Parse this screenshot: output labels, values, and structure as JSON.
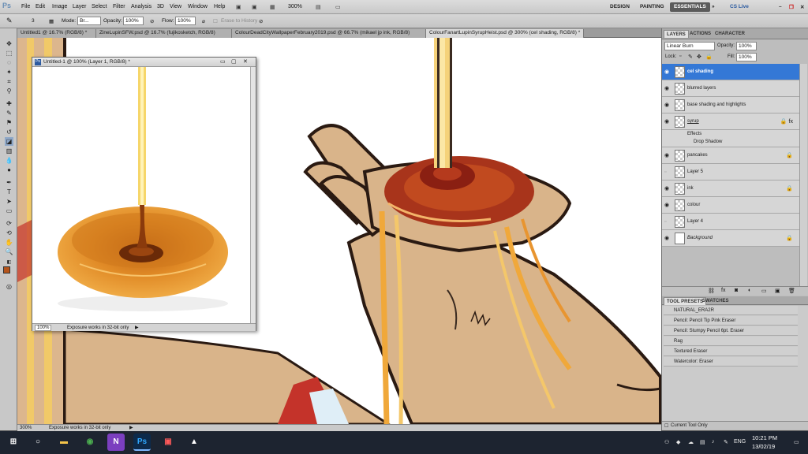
{
  "app": {
    "logo": "Ps"
  },
  "menubar": {
    "items": [
      "File",
      "Edit",
      "Image",
      "Layer",
      "Select",
      "Filter",
      "Analysis",
      "3D",
      "View",
      "Window",
      "Help"
    ],
    "zoom": "300%",
    "workspaces": [
      "DESIGN",
      "PAINTING",
      "ESSENTIALS"
    ],
    "cslive": "CS Live"
  },
  "options": {
    "brush_size": "3",
    "mode_label": "Mode:",
    "mode_value": "Br...",
    "opacity_label": "Opacity:",
    "opacity_value": "100%",
    "flow_label": "Flow:",
    "flow_value": "100%",
    "erase_history": "Erase to History"
  },
  "tabs": [
    "Untitled1 @ 16.7% (RGB/8) *",
    "ZineLupinSFW.psd @ 16.7% (fujikosketch, RGB/8)",
    "ColourDeadCityWallpaperFebruary2019.psd @ 66.7% (mikael jp ink, RGB/8)",
    "ColourFanartLupinSyrupHeist.psd @ 300% (cel shading, RGB/8) *"
  ],
  "float_window": {
    "title": "Untitled-1 @ 100% (Layer 1, RGB/8) *",
    "zoom": "100%",
    "status": "Exposure works in 32-bit only"
  },
  "status": {
    "zoom": "300%",
    "text": "Exposure works in 32-bit only"
  },
  "layers_panel": {
    "tabs": [
      "LAYERS",
      "ACTIONS",
      "CHARACTER"
    ],
    "blend_mode": "Linear Burn",
    "opacity_label": "Opacity:",
    "opacity_value": "100%",
    "lock_label": "Lock:",
    "fill_label": "Fill:",
    "fill_value": "100%",
    "layers": [
      {
        "name": "cel shading",
        "selected": true,
        "visible": true
      },
      {
        "name": "blurred layers",
        "visible": true
      },
      {
        "name": "base shading and highlights",
        "visible": true
      },
      {
        "name": "syrup",
        "visible": true,
        "fx": true
      },
      {
        "name": "pancakes",
        "visible": true,
        "locked": true
      },
      {
        "name": "Layer 5",
        "visible": false
      },
      {
        "name": "ink",
        "visible": true,
        "locked": true
      },
      {
        "name": "colour",
        "visible": true
      },
      {
        "name": "Layer 4",
        "visible": false
      },
      {
        "name": "Background",
        "visible": true,
        "locked": true
      }
    ],
    "effects_label": "Effects",
    "drop_shadow_label": "Drop Shadow"
  },
  "tool_presets": {
    "tabs": [
      "TOOL PRESETS",
      "SWATCHES"
    ],
    "items": [
      "NATURAL_ERA2R",
      "Pencil: Pencil Tip Pink Eraser",
      "Pencil: Stumpy Pencil 6pt. Eraser",
      "Rag",
      "Textured Eraser",
      "Watercolor: Eraser"
    ],
    "current_only": "Current Tool Only"
  },
  "taskbar": {
    "lang": "ENG",
    "time": "10:21 PM",
    "date": "13/02/19"
  },
  "colors": {
    "accent": "#3478d6",
    "syrup": "#c8751e",
    "skin": "#d9b48a"
  }
}
